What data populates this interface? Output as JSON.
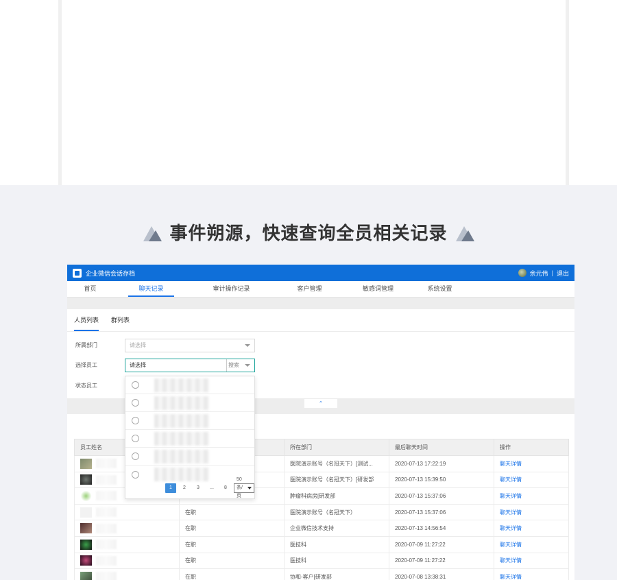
{
  "headline": {
    "text": "事件朔源，快速查询全员相关记录"
  },
  "app": {
    "title": "企业微信会话存档",
    "user_name": "余元伟",
    "separator": "|",
    "logout": "退出"
  },
  "nav": [
    "首页",
    "聊天记录",
    "审计操作记录",
    "客户管理",
    "敏感词管理",
    "系统设置"
  ],
  "tabs": [
    "人员列表",
    "群列表"
  ],
  "filters": {
    "dept_label": "所属部门",
    "dept_placeholder": "请选择",
    "employee_label": "选择员工",
    "employee_placeholder": "请选择",
    "employee_search": "搜索",
    "status_label": "状态员工"
  },
  "pager": {
    "pages": [
      "1",
      "2",
      "3",
      "...",
      "8"
    ],
    "size": "50 条/页"
  },
  "table": {
    "headers": [
      "员工姓名",
      "",
      "所在部门",
      "最后聊天时间",
      "操作"
    ],
    "rows": [
      {
        "status": "",
        "dept": "医院演示账号（名冠天下）[测试...",
        "time": "2020-07-13 17:22:19",
        "op": "聊天详情"
      },
      {
        "status": "",
        "dept": "医院演示账号（名冠天下）[研发部",
        "time": "2020-07-13 15:39:50",
        "op": "聊天详情"
      },
      {
        "status": "",
        "dept": "肿瘤科病房[研发部",
        "time": "2020-07-13 15:37:06",
        "op": "聊天详情"
      },
      {
        "status": "在职",
        "dept": "医院演示账号（名冠天下）",
        "time": "2020-07-13 15:37:06",
        "op": "聊天详情"
      },
      {
        "status": "在职",
        "dept": "企业微信技术支持",
        "time": "2020-07-13 14:56:54",
        "op": "聊天详情"
      },
      {
        "status": "在职",
        "dept": "医技科",
        "time": "2020-07-09 11:27:22",
        "op": "聊天详情"
      },
      {
        "status": "在职",
        "dept": "医技科",
        "time": "2020-07-09 11:27:22",
        "op": "聊天详情"
      },
      {
        "status": "在职",
        "dept": "协和-客户[研发部",
        "time": "2020-07-08 13:38:31",
        "op": "聊天详情"
      }
    ]
  },
  "collapse_icon": "chevron-up-icon"
}
